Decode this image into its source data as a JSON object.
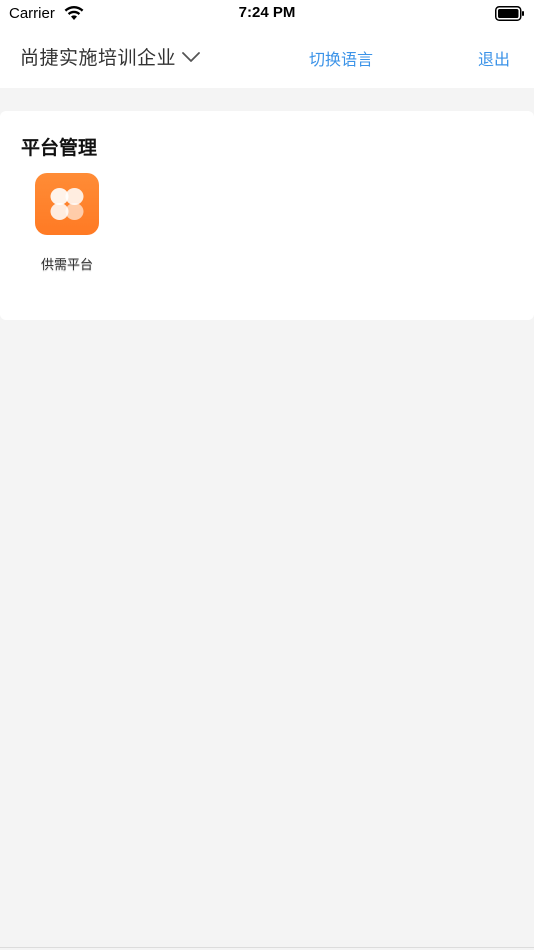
{
  "status_bar": {
    "carrier": "Carrier",
    "time": "7:24 PM"
  },
  "nav": {
    "company_name": "尚捷实施培训企业",
    "switch_language": "切换语言",
    "logout": "退出"
  },
  "section": {
    "title": "平台管理",
    "apps": [
      {
        "label": "供需平台",
        "icon": "clover-icon"
      }
    ]
  },
  "colors": {
    "accent": "#3b93e8",
    "app_icon_bg": "#ff7a24",
    "page_bg": "#f4f4f4"
  }
}
